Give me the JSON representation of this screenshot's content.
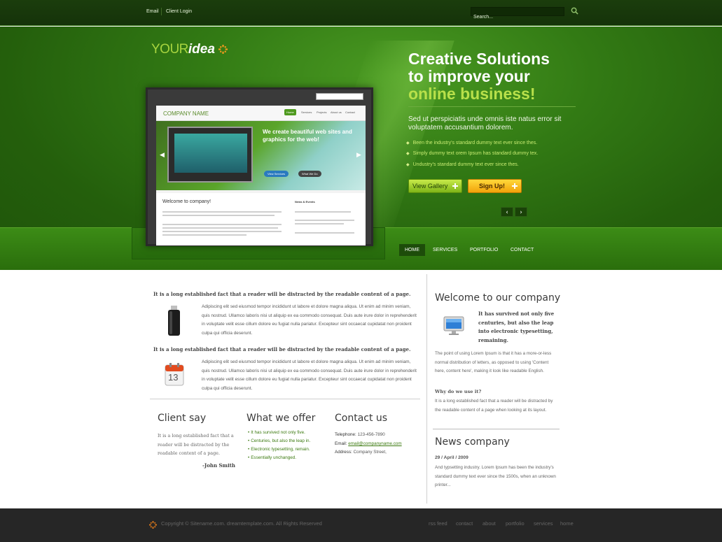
{
  "topbar": {
    "email_label": "Email",
    "login_label": "Client Login",
    "search_placeholder": "Search..."
  },
  "logo": {
    "word1": "YOUR",
    "word2": "idea"
  },
  "mockup": {
    "company_name": "COMPANY NAME",
    "nav": [
      "Home",
      "Services",
      "Projects",
      "About us",
      "Contact"
    ],
    "headline": "We create beautiful web sites and graphics for the web!",
    "btn_view": "View Services",
    "btn_what": "What We Do",
    "welcome": "Welcome to company!",
    "news": "News & Events"
  },
  "hero": {
    "title_line1": "Creative Solutions",
    "title_line2": "to improve your",
    "title_line3": "online business!",
    "subtitle": "Sed ut perspiciatis unde omnis iste natus error sit voluptatem accusantium dolorem.",
    "bullets": [
      "Been the industry's standard dummy text ever since thes.",
      "Simply dummy text orem Ipsum has standard dummy tex.",
      "Undustry's standard dummy text ever since thes."
    ],
    "gallery_label": "View Gallery",
    "signup_label": "Sign Up!",
    "prev_label": "‹",
    "next_label": "›"
  },
  "nav": {
    "items": [
      "HOME",
      "SERVICES",
      "PORTFOLIO",
      "CONTACT"
    ],
    "active": "HOME"
  },
  "content": {
    "lead1": "It is a long established fact that a reader will be distracted by the readable content of a page.",
    "para1": "Adipiscing elit sed eiusmod tempor incididunt ut labore et dolore magna aliqua. Ut enim ad minim veniam, quis nostrud. Ullamco laboris nisi ut aliquip ex ea commodo consequat. Duis aute irure dolor in reprehenderit in voluptate velit esse cillum dolore eu fugiat nulla pariatur. Excepteur sint occaecat cupidatat non proident culpa qui officia deserunt.",
    "lead2": "It is a long established fact that a reader will be distracted by the readable content of a page.",
    "para2": "Adipiscing elit sed eiusmod tempor incididunt ut labore et dolore magna aliqua. Ut enim ad minim veniam, quis nostrud. Ullamco laboris nisi ut aliquip ex ea commodo consequat. Duis aute irure dolor in reprehenderit in voluptate velit esse cillum dolore eu fugiat nulla pariatur. Excepteur sint occaecat cupidatat non proident culpa qui officia deserunt.",
    "calendar_day": "13"
  },
  "client": {
    "title": "Client say",
    "text": "It is a long established fact that a reader will be distracted by the readable content of a page.",
    "author": "-John Smith"
  },
  "offer": {
    "title": "What we offer",
    "items": [
      "It has survived not only five.",
      "Centuries, but also the leap in.",
      "Electronic typesetting, remain.",
      "Essentially unchanged."
    ]
  },
  "contact": {
    "title": "Contact us",
    "telephone_label": "Telephone:",
    "telephone": "123-456-7890",
    "email_label": "Email:",
    "email": "email@companyname.com",
    "address_label": "Address:",
    "address": "Company Street,"
  },
  "sidebar": {
    "welcome_title": "Welcome to our company",
    "welcome_bold": "It has survived not only five centuries, but also the leap into electronic typesetting, remaining.",
    "welcome_text": "The point of using Lorem Ipsum is that it has a more-or-less normal distribution of letters, as opposed to using 'Content here, content here', making it look like readable English.",
    "why_title": "Why do we use it?",
    "why_text": "It is a long established fact that a reader will be distracted by the readable content of a page when looking at its layout.",
    "news_title": "News company",
    "news_date": "29 / April / 2009",
    "news_text": "And typsetting industry. Lorem Ipsum has been the industry's standard dummy text ever since the 1500s, when an unknown printer..."
  },
  "footer": {
    "copyright": "Copyright © Sitename.com. dreamtemplate.com. All Rights Reserved",
    "links": [
      "rss feed",
      "contact",
      "about",
      "portfolio",
      "services",
      "home"
    ]
  },
  "colors": {
    "brand_green": "#327a14",
    "accent_lime": "#b8e04a",
    "signup_orange": "#f2a20a",
    "footer_bg": "#262626"
  }
}
